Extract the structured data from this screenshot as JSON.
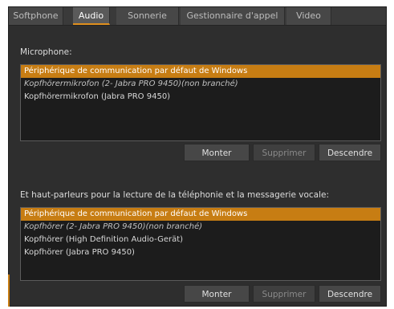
{
  "tabs": [
    {
      "label": "Softphone",
      "active": false
    },
    {
      "label": "Audio",
      "active": true
    },
    {
      "label": "Sonnerie",
      "active": false
    },
    {
      "label": "Gestionnaire d'appel",
      "active": false
    },
    {
      "label": "Video",
      "active": false
    }
  ],
  "microphone": {
    "label": "Microphone:",
    "items": [
      {
        "text": "Périphérique de communication par défaut de Windows",
        "selected": true,
        "italic": false
      },
      {
        "text": "Kopfhörermikrofon (2- Jabra PRO 9450)(non branché)",
        "selected": false,
        "italic": true
      },
      {
        "text": "Kopfhörermikrofon (Jabra PRO 9450)",
        "selected": false,
        "italic": false
      }
    ],
    "buttons": {
      "up": "Monter",
      "delete": "Supprimer",
      "down": "Descendre"
    }
  },
  "speakers": {
    "label": "Et haut-parleurs pour la lecture de la téléphonie et la messagerie vocale:",
    "items": [
      {
        "text": "Périphérique de communication par défaut de Windows",
        "selected": true,
        "italic": false
      },
      {
        "text": "Kopfhörer (2- Jabra PRO 9450)(non branché)",
        "selected": false,
        "italic": true
      },
      {
        "text": "Kopfhörer (High Definition Audio-Gerät)",
        "selected": false,
        "italic": false
      },
      {
        "text": "Kopfhörer (Jabra PRO 9450)",
        "selected": false,
        "italic": false
      }
    ],
    "buttons": {
      "up": "Monter",
      "delete": "Supprimer",
      "down": "Descendre"
    }
  },
  "colors": {
    "accent": "#c77d13",
    "panel": "#2e2e2e",
    "tab_underline": "#e08f1e"
  }
}
